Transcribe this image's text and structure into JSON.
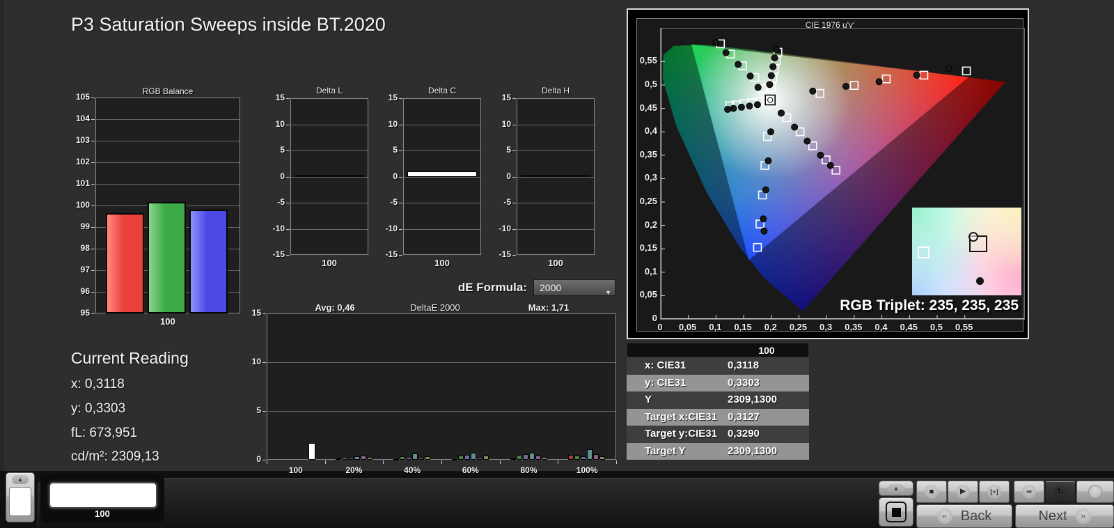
{
  "title": "P3 Saturation Sweeps inside BT.2020",
  "de_formula": {
    "label": "dE Formula:",
    "selected": "2000"
  },
  "current_reading": {
    "heading": "Current Reading",
    "x": "x: 0,3118",
    "y": "y: 0,3303",
    "fl": "fL: 673,951",
    "cdm2": "cd/m²: 2309,13"
  },
  "chart_data": {
    "rgb_balance": {
      "type": "bar",
      "title": "RGB Balance",
      "categories": [
        "Red",
        "Green",
        "Blue"
      ],
      "values": [
        99.65,
        100.15,
        99.8
      ],
      "colors": [
        "#e8423a",
        "#3cab47",
        "#4a49e4"
      ],
      "colors_light": [
        "#ff8a80",
        "#8bd68c",
        "#9290ff"
      ],
      "ylim": [
        95,
        105
      ],
      "ytick_step": 1,
      "xlabel": "100"
    },
    "delta_small_charts": {
      "type": "bar",
      "ylim": [
        -15,
        15
      ],
      "ytick_step": 5,
      "xlabel": "100",
      "charts": [
        {
          "title": "Delta L",
          "value": 0.1,
          "white": false
        },
        {
          "title": "Delta C",
          "value": 1.0,
          "white": true
        },
        {
          "title": "Delta H",
          "value": 0.1,
          "white": false
        }
      ]
    },
    "deltae_2000": {
      "type": "bar",
      "title": "DeltaE 2000",
      "avg_label": "Avg: 0,46",
      "max_label": "Max: 1,71",
      "ylim": [
        0,
        15
      ],
      "yticks": [
        0,
        5,
        10,
        15
      ],
      "categories": [
        "100",
        "20%",
        "40%",
        "60%",
        "80%",
        "100%"
      ],
      "white_bar": {
        "category": "100",
        "value": 1.71,
        "color": "#ffffff"
      },
      "series_colors": [
        "#a63b2a",
        "#4f7d43",
        "#6c6c9e",
        "#5f8f8f",
        "#8f5f8f",
        "#8a8a55"
      ],
      "groups": [
        {
          "label": "20%",
          "values": [
            0.12,
            0.32,
            0.18,
            0.38,
            0.42,
            0.28
          ]
        },
        {
          "label": "40%",
          "values": [
            0.1,
            0.38,
            0.26,
            0.62,
            0.18,
            0.33
          ]
        },
        {
          "label": "60%",
          "values": [
            0.1,
            0.44,
            0.5,
            0.68,
            0.18,
            0.4
          ]
        },
        {
          "label": "80%",
          "values": [
            0.16,
            0.5,
            0.55,
            0.7,
            0.44,
            0.3
          ]
        },
        {
          "label": "100%",
          "values": [
            0.5,
            0.4,
            0.34,
            1.05,
            0.55,
            0.34
          ]
        }
      ]
    },
    "cie_1976": {
      "type": "scatter",
      "title": "CIE 1976 u'v'",
      "rgb_triplet": "RGB Triplet: 235, 235, 235",
      "x_ticks": [
        "0",
        "0,05",
        "0,1",
        "0,15",
        "0,2",
        "0,25",
        "0,3",
        "0,35",
        "0,4",
        "0,45",
        "0,5",
        "0,55"
      ],
      "y_ticks": [
        "0",
        "0,05",
        "0,1",
        "0,15",
        "0,2",
        "0,25",
        "0,3",
        "0,35",
        "0,4",
        "0,45",
        "0,5",
        "0,55"
      ],
      "locus_uv": [
        [
          0.6234,
          0.5065
        ],
        [
          0.5203,
          0.5219
        ],
        [
          0.4035,
          0.5393
        ],
        [
          0.2623,
          0.5604
        ],
        [
          0.1531,
          0.5766
        ],
        [
          0.0792,
          0.5856
        ],
        [
          0.0231,
          0.5837
        ],
        [
          0.0046,
          0.5638
        ],
        [
          0.0035,
          0.5131
        ],
        [
          0.0282,
          0.4117
        ],
        [
          0.0828,
          0.2708
        ],
        [
          0.1441,
          0.151
        ],
        [
          0.1877,
          0.0871
        ],
        [
          0.2568,
          0.0166
        ]
      ],
      "gamut_triangle_uv": [
        [
          0.5566,
          0.5165
        ],
        [
          0.0556,
          0.5868
        ],
        [
          0.1593,
          0.1258
        ]
      ],
      "white_point": {
        "target": [
          0.198,
          0.468
        ]
      },
      "sweeps": [
        {
          "name": "red",
          "targets": [
            [
              0.288,
              0.482
            ],
            [
              0.35,
              0.499
            ],
            [
              0.408,
              0.513
            ],
            [
              0.476,
              0.521
            ],
            [
              0.553,
              0.53
            ]
          ],
          "measured": [
            [
              0.275,
              0.487
            ],
            [
              0.335,
              0.497
            ],
            [
              0.395,
              0.507
            ],
            [
              0.463,
              0.521
            ],
            [
              0.521,
              0.535
            ]
          ]
        },
        {
          "name": "green",
          "targets": [
            [
              0.184,
              0.492
            ],
            [
              0.17,
              0.516
            ],
            [
              0.148,
              0.541
            ],
            [
              0.126,
              0.566
            ],
            [
              0.108,
              0.588
            ]
          ],
          "measured": [
            [
              0.176,
              0.495
            ],
            [
              0.162,
              0.519
            ],
            [
              0.14,
              0.544
            ],
            [
              0.118,
              0.569
            ],
            [
              0.1,
              0.591
            ]
          ]
        },
        {
          "name": "blue",
          "targets": [
            [
              0.193,
              0.39
            ],
            [
              0.1885,
              0.328
            ],
            [
              0.184,
              0.265
            ],
            [
              0.1795,
              0.203
            ],
            [
              0.175,
              0.153
            ]
          ],
          "measured": [
            [
              0.199,
              0.4
            ],
            [
              0.1945,
              0.338
            ],
            [
              0.19,
              0.276
            ],
            [
              0.1855,
              0.214
            ],
            [
              0.187,
              0.188
            ]
          ]
        },
        {
          "name": "cyan",
          "targets": [
            [
              0.18,
              0.465
            ],
            [
              0.1655,
              0.4625
            ],
            [
              0.151,
              0.46
            ],
            [
              0.1365,
              0.4575
            ],
            [
              0.125,
              0.4555
            ]
          ],
          "measured": [
            [
              0.175,
              0.458
            ],
            [
              0.1605,
              0.455
            ],
            [
              0.146,
              0.4525
            ],
            [
              0.1315,
              0.45
            ],
            [
              0.121,
              0.448
            ]
          ]
        },
        {
          "name": "magenta",
          "targets": [
            [
              0.228,
              0.43
            ],
            [
              0.252,
              0.4
            ],
            [
              0.275,
              0.37
            ],
            [
              0.299,
              0.34
            ],
            [
              0.317,
              0.318
            ]
          ],
          "measured": [
            [
              0.218,
              0.44
            ],
            [
              0.242,
              0.41
            ],
            [
              0.265,
              0.38
            ],
            [
              0.289,
              0.35
            ],
            [
              0.307,
              0.328
            ]
          ]
        },
        {
          "name": "yellow",
          "targets": [
            [
              0.2,
              0.495
            ],
            [
              0.203,
              0.514
            ],
            [
              0.206,
              0.533
            ],
            [
              0.209,
              0.552
            ],
            [
              0.212,
              0.57
            ]
          ],
          "measured": [
            [
              0.197,
              0.501
            ],
            [
              0.2,
              0.52
            ],
            [
              0.203,
              0.539
            ],
            [
              0.206,
              0.558
            ],
            [
              0.209,
              0.576
            ]
          ]
        }
      ]
    }
  },
  "results_table": {
    "header": "100",
    "rows": [
      {
        "label": "x: CIE31",
        "value": "0,3118"
      },
      {
        "label": "y: CIE31",
        "value": "0,3303"
      },
      {
        "label": "Y",
        "value": "2309,1300"
      },
      {
        "label": "Target x:CIE31",
        "value": "0,3127"
      },
      {
        "label": "Target y:CIE31",
        "value": "0,3290"
      },
      {
        "label": "Target Y",
        "value": "2309,1300"
      }
    ]
  },
  "bottom_bar": {
    "swatch_label": "100",
    "back_label": "Back",
    "next_label": "Next",
    "back_glyph": "«",
    "next_glyph": "»",
    "icons": [
      "stop",
      "play",
      "bracket",
      "infinity",
      "refresh",
      "record"
    ]
  }
}
